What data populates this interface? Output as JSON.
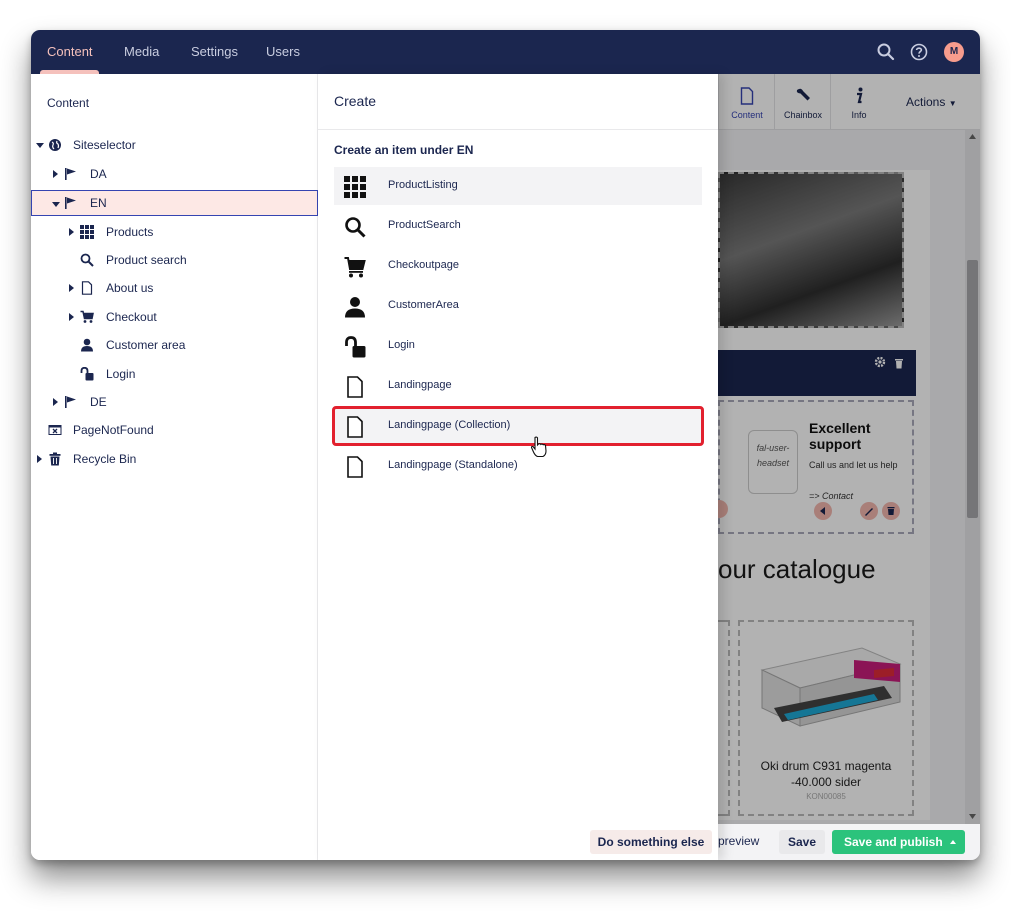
{
  "topbar": {
    "sections": [
      "Content",
      "Media",
      "Settings",
      "Users"
    ],
    "active_section": "Content",
    "avatar_initial": "M",
    "icons": [
      "search-icon",
      "help-icon",
      "user-avatar"
    ]
  },
  "tree": {
    "title": "Content",
    "items": [
      {
        "label": "Siteselector",
        "icon": "globe-icon"
      },
      {
        "label": "DA",
        "icon": "flag-icon"
      },
      {
        "label": "EN",
        "icon": "flag-icon"
      },
      {
        "label": "Products",
        "icon": "grid-icon"
      },
      {
        "label": "Product search",
        "icon": "search-icon"
      },
      {
        "label": "About us",
        "icon": "document-icon"
      },
      {
        "label": "Checkout",
        "icon": "cart-icon"
      },
      {
        "label": "Customer area",
        "icon": "user-icon"
      },
      {
        "label": "Login",
        "icon": "unlock-icon"
      },
      {
        "label": "DE",
        "icon": "flag-icon"
      },
      {
        "label": "PageNotFound",
        "icon": "error-page-icon"
      },
      {
        "label": "Recycle Bin",
        "icon": "trash-icon"
      }
    ]
  },
  "create": {
    "title": "Create",
    "subtitle": "Create an item under EN",
    "items": [
      {
        "label": "ProductListing",
        "icon": "grid-icon"
      },
      {
        "label": "ProductSearch",
        "icon": "search-icon"
      },
      {
        "label": "Checkoutpage",
        "icon": "cart-icon"
      },
      {
        "label": "CustomerArea",
        "icon": "user-icon"
      },
      {
        "label": "Login",
        "icon": "unlock-icon"
      },
      {
        "label": "Landingpage",
        "icon": "document-icon"
      },
      {
        "label": "Landingpage (Collection)",
        "icon": "document-icon"
      },
      {
        "label": "Landingpage (Standalone)",
        "icon": "document-icon"
      }
    ],
    "do_something_else": "Do something else"
  },
  "editor": {
    "tabs": [
      {
        "label": "Content",
        "icon": "document-icon"
      },
      {
        "label": "Chainbox",
        "icon": "wrench-icon"
      },
      {
        "label": "Info",
        "icon": "info-icon"
      }
    ],
    "actions_label": "Actions",
    "support": {
      "image_alt": "fal-user-headset",
      "title": "Excellent support",
      "text": "Call us and let us help",
      "link": "=> Contact"
    },
    "catalogue_heading": "our catalogue",
    "product": {
      "name": "Oki drum C931 magenta -40.000 sider",
      "sku": "KON00085"
    },
    "footer": {
      "preview": "preview",
      "save": "Save",
      "save_publish": "Save and publish"
    }
  },
  "colors": {
    "navy": "#1b264f",
    "accent_pink": "#f5c1bc",
    "highlight_red": "#e2202e",
    "publish_green": "#2bc37c"
  }
}
